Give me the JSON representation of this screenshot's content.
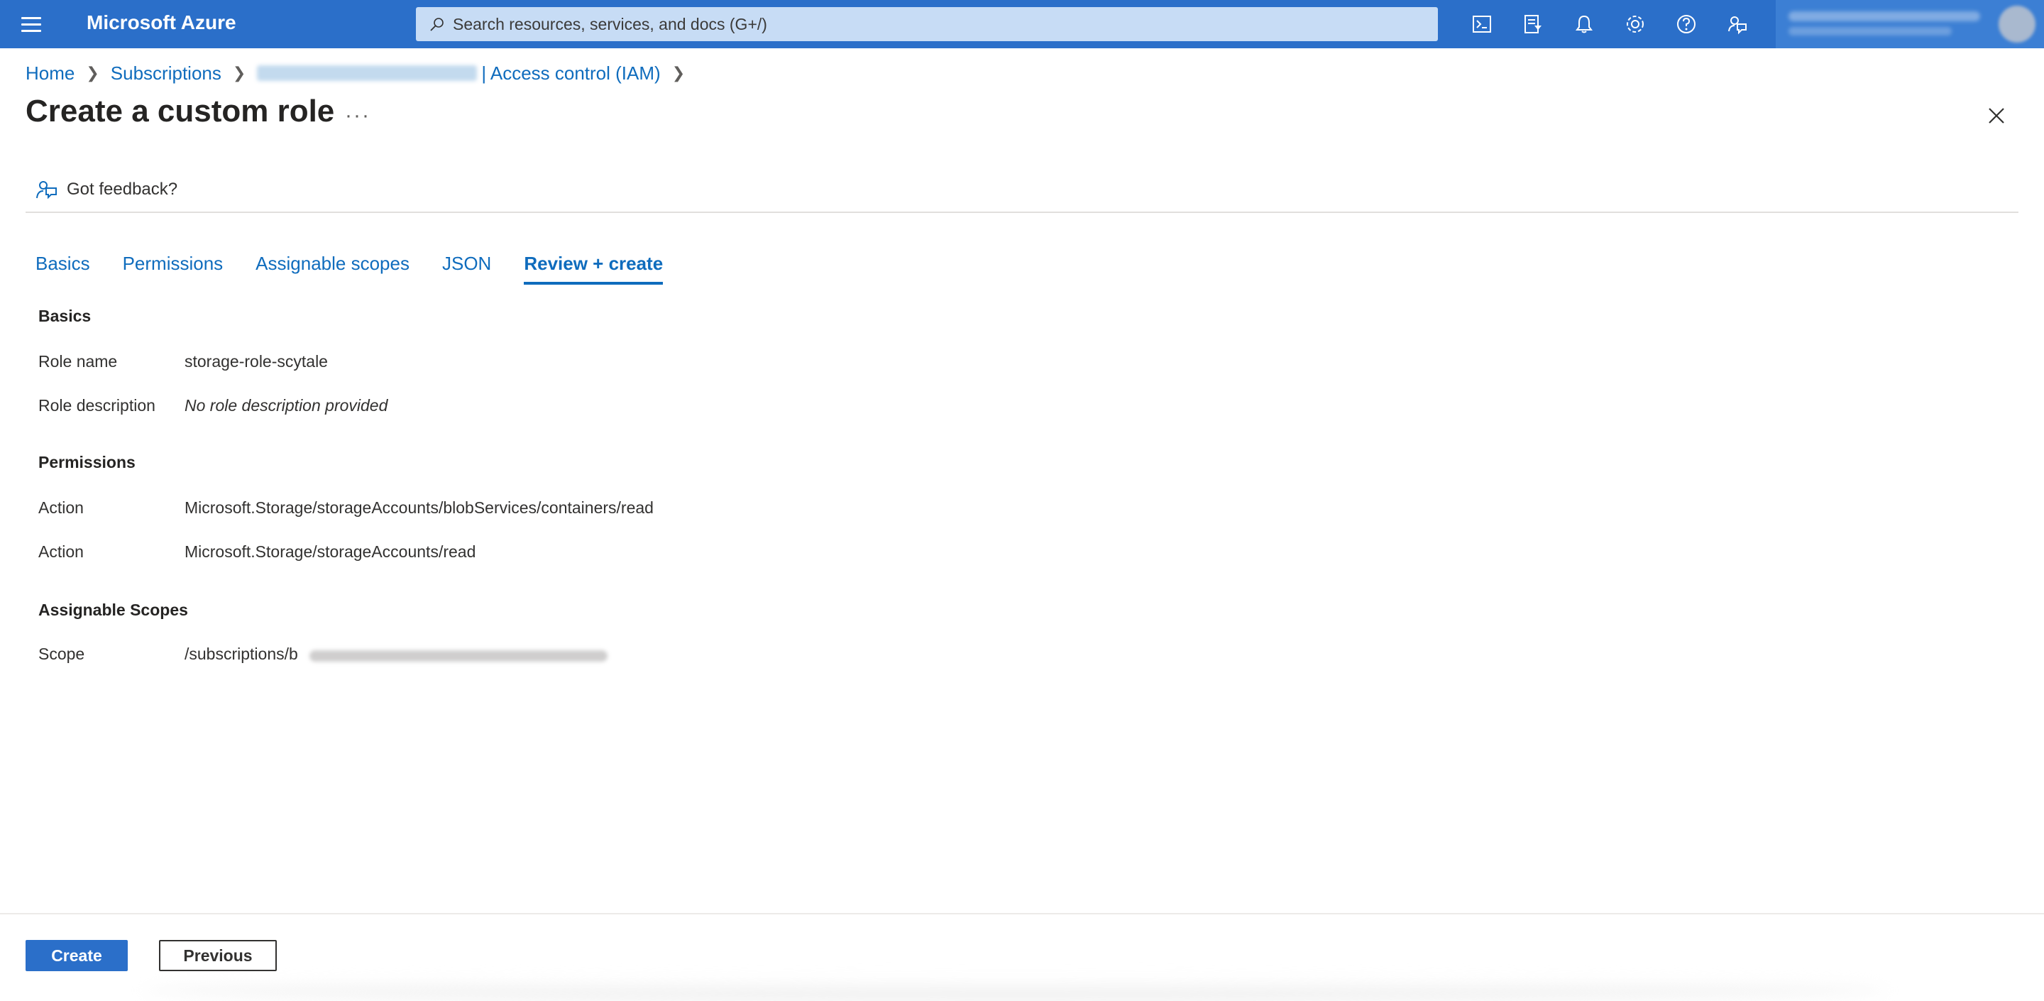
{
  "topbar": {
    "brand": "Microsoft Azure",
    "search_placeholder": "Search resources, services, and docs (G+/)",
    "icons": [
      "cloud-shell-icon",
      "directory-filter-icon",
      "notifications-icon",
      "settings-icon",
      "help-icon",
      "feedback-icon"
    ],
    "accent_color": "#2b6fc9"
  },
  "breadcrumb": {
    "items": [
      "Home",
      "Subscriptions",
      "| Access control (IAM)"
    ]
  },
  "page": {
    "title": "Create a custom role",
    "more": "···"
  },
  "feedback": {
    "label": "Got feedback?"
  },
  "tabs": [
    {
      "label": "Basics",
      "active": false
    },
    {
      "label": "Permissions",
      "active": false
    },
    {
      "label": "Assignable scopes",
      "active": false
    },
    {
      "label": "JSON",
      "active": false
    },
    {
      "label": "Review + create",
      "active": true
    }
  ],
  "review": {
    "basics": {
      "title": "Basics",
      "role_name_label": "Role name",
      "role_name_value": "storage-role-scytale",
      "role_description_label": "Role description",
      "role_description_value": "No role description provided"
    },
    "permissions": {
      "title": "Permissions",
      "actions": [
        {
          "label": "Action",
          "value": "Microsoft.Storage/storageAccounts/blobServices/containers/read"
        },
        {
          "label": "Action",
          "value": "Microsoft.Storage/storageAccounts/read"
        }
      ]
    },
    "scopes": {
      "title": "Assignable Scopes",
      "scope_label": "Scope",
      "scope_value": "/subscriptions/b"
    }
  },
  "footer": {
    "create_label": "Create",
    "previous_label": "Previous"
  }
}
